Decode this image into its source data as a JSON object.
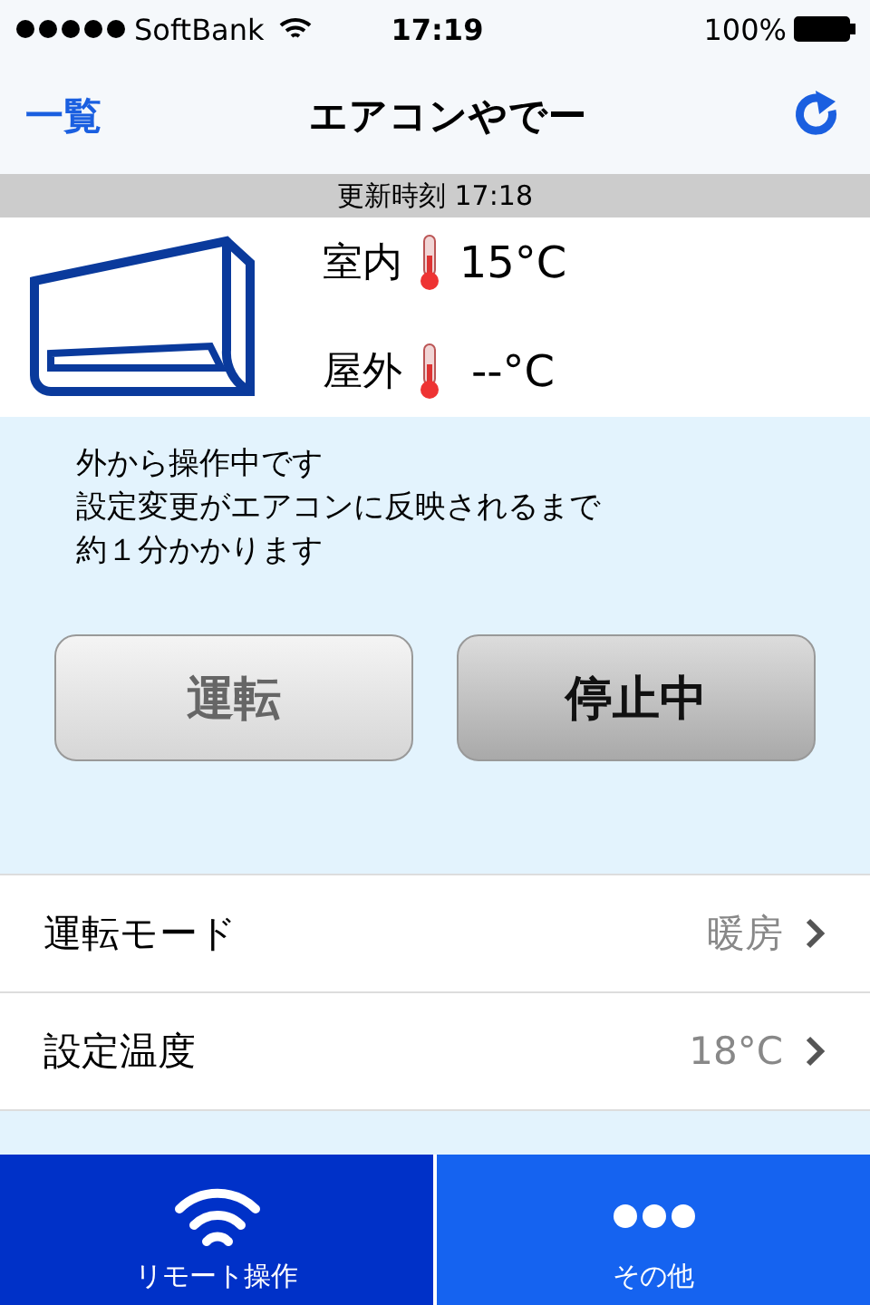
{
  "status_bar": {
    "carrier": "SoftBank",
    "time": "17:19",
    "battery": "100%"
  },
  "nav": {
    "back": "一覧",
    "title": "エアコンやでー"
  },
  "updated": "更新時刻 17:18",
  "temperatures": [
    {
      "label": "室内",
      "value": "15",
      "unit": "°C"
    },
    {
      "label": "屋外",
      "value": "--",
      "unit": "°C"
    }
  ],
  "notice": [
    "外から操作中です",
    "設定変更がエアコンに反映されるまで",
    "約１分かかります"
  ],
  "power_buttons": [
    {
      "label": "運転",
      "selected": false
    },
    {
      "label": "停止中",
      "selected": true
    }
  ],
  "settings": [
    {
      "label": "運転モード",
      "value": "暖房"
    },
    {
      "label": "設定温度",
      "value": "18°C"
    }
  ],
  "tabs": [
    {
      "label": "リモート操作",
      "kind": "wifi",
      "selected": true
    },
    {
      "label": "その他",
      "kind": "more",
      "selected": false
    }
  ]
}
